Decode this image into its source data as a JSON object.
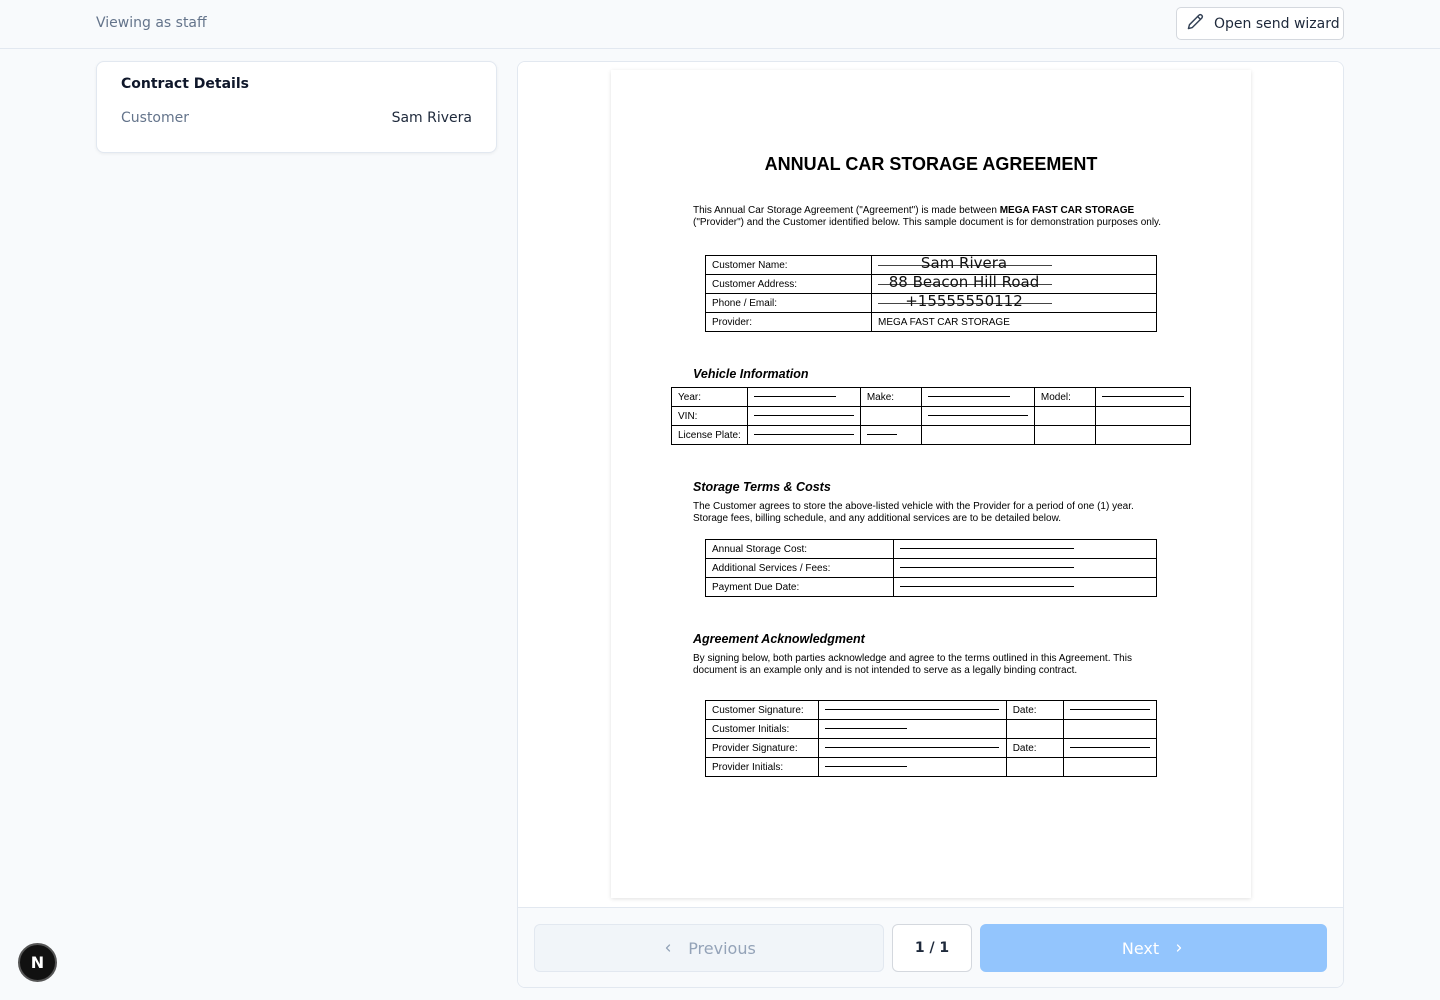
{
  "topbar": {
    "viewing_label": "Viewing as staff",
    "wizard_button": "Open send wizard",
    "wizard_icon": "pencil-icon"
  },
  "details": {
    "title": "Contract Details",
    "customer_label": "Customer",
    "customer_value": "Sam Rivera"
  },
  "document": {
    "title": "ANNUAL CAR STORAGE AGREEMENT",
    "intro_1": "This Annual Car Storage Agreement (\"Agreement\") is made between ",
    "intro_bold": "MEGA FAST CAR STORAGE",
    "intro_2": " (\"Provider\") and the Customer identified below. This sample document is for demonstration purposes only.",
    "customer_table": {
      "name_label": "Customer Name:",
      "name_value": "Sam Rivera",
      "address_label": "Customer Address:",
      "address_value": "88 Beacon Hill Road",
      "phone_label": "Phone / Email:",
      "phone_value": "+15555550112",
      "provider_label": "Provider:",
      "provider_value": "MEGA FAST CAR STORAGE"
    },
    "vehicle_heading": "Vehicle Information",
    "vehicle_table": {
      "year_label": "Year:",
      "make_label": "Make:",
      "model_label": "Model:",
      "vin_label": "VIN:",
      "plate_label": "License Plate:"
    },
    "storage_heading": "Storage Terms & Costs",
    "storage_text": "The Customer agrees to store the above-listed vehicle with the Provider for a period of one (1) year. Storage fees, billing schedule, and any additional services are to be detailed below.",
    "cost_table": {
      "annual_label": "Annual Storage Cost:",
      "additional_label": "Additional Services / Fees:",
      "due_label": "Payment Due Date:"
    },
    "ack_heading": "Agreement Acknowledgment",
    "ack_text": "By signing below, both parties acknowledge and agree to the terms outlined in this Agreement. This document is an example only and is not intended to serve as a legally binding contract.",
    "sign_table": {
      "customer_sig_label": "Customer Signature:",
      "customer_init_label": "Customer Initials:",
      "provider_sig_label": "Provider Signature:",
      "provider_init_label": "Provider Initials:",
      "date_label": "Date:"
    }
  },
  "pager": {
    "previous": "Previous",
    "page_indicator": "1 / 1",
    "next": "Next"
  },
  "badge": {
    "letter": "N"
  }
}
